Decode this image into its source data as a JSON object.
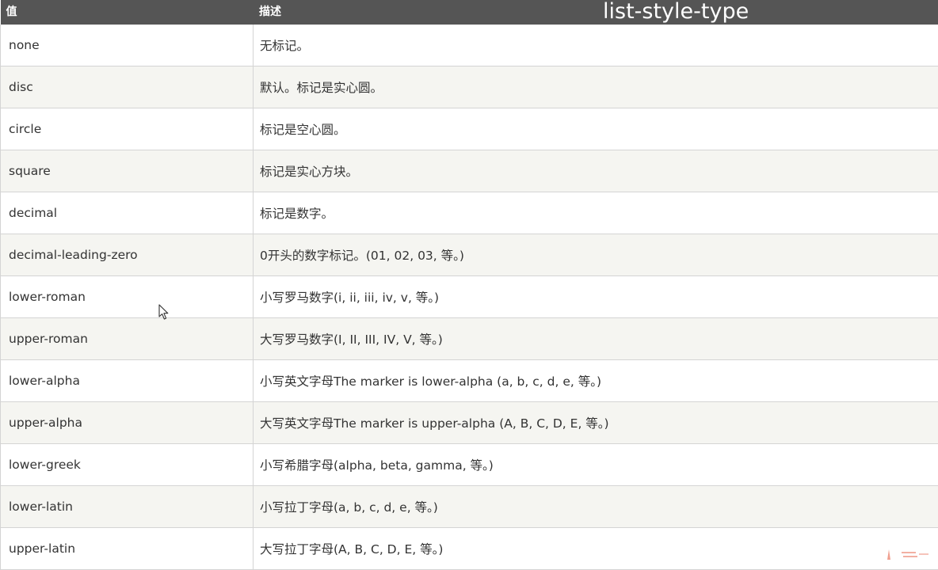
{
  "table": {
    "headers": {
      "value": "值",
      "description": "描述"
    },
    "rows": [
      {
        "value": "none",
        "description": "无标记。"
      },
      {
        "value": "disc",
        "description": "默认。标记是实心圆。"
      },
      {
        "value": "circle",
        "description": "标记是空心圆。"
      },
      {
        "value": "square",
        "description": "标记是实心方块。"
      },
      {
        "value": "decimal",
        "description": "标记是数字。"
      },
      {
        "value": "decimal-leading-zero",
        "description": "0开头的数字标记。(01, 02, 03, 等。)"
      },
      {
        "value": "lower-roman",
        "description": "小写罗马数字(i, ii, iii, iv, v, 等。)"
      },
      {
        "value": "upper-roman",
        "description": "大写罗马数字(I, II, III, IV, V, 等。)"
      },
      {
        "value": "lower-alpha",
        "description": "小写英文字母The marker is lower-alpha (a, b, c, d, e, 等。)"
      },
      {
        "value": "upper-alpha",
        "description": "大写英文字母The marker is upper-alpha (A, B, C, D, E, 等。)"
      },
      {
        "value": "lower-greek",
        "description": "小写希腊字母(alpha, beta, gamma, 等。)"
      },
      {
        "value": "lower-latin",
        "description": "小写拉丁字母(a, b, c, d, e, 等。)"
      },
      {
        "value": "upper-latin",
        "description": "大写拉丁字母(A, B, C, D, E, 等。)"
      }
    ]
  },
  "overlay": {
    "title": "list-style-type"
  },
  "cursor": {
    "icon": "mouse-pointer-icon"
  },
  "colors": {
    "header_bg": "#555555",
    "header_text": "#ffffff",
    "row_alt_bg": "#f5f5f1",
    "border": "#d4d4d4",
    "text": "#333333",
    "corner_mark": "#e0452f"
  }
}
